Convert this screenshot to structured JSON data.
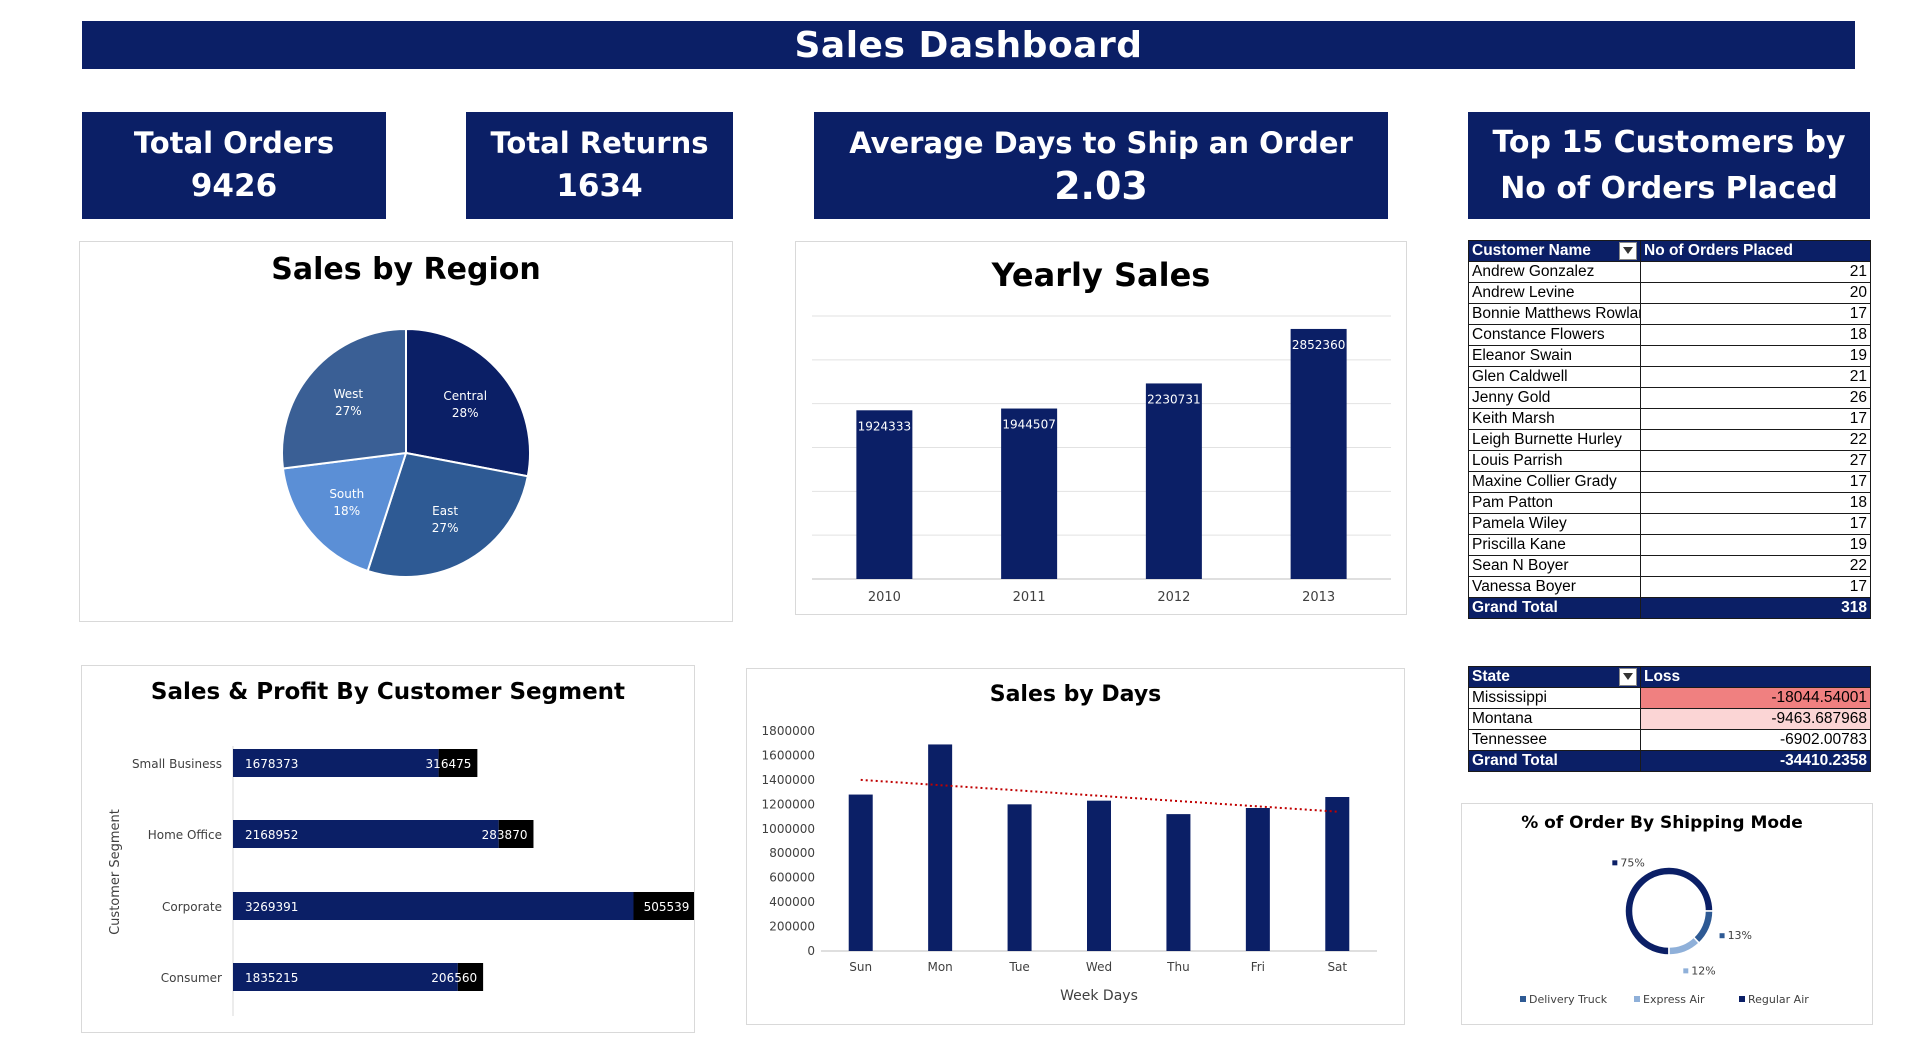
{
  "dashboard": {
    "title": "Sales Dashboard",
    "kpis": {
      "total_orders_label": "Total Orders",
      "total_orders_value": "9426",
      "total_returns_label": "Total Returns",
      "total_returns_value": "1634",
      "avg_ship_label": "Average Days to Ship an Order",
      "avg_ship_value": "2.03",
      "top_customers_label_1": "Top 15 Customers by",
      "top_customers_label_2": "No of  Orders Placed"
    }
  },
  "colors": {
    "navy": "#0b1f66",
    "pie_central": "#0b1f66",
    "pie_east": "#2e5a94",
    "pie_south": "#5b8fd6",
    "pie_west": "#3a5f95",
    "profit_bar": "#000000",
    "trendline": "#c00000",
    "loss_strong": "#f08080",
    "loss_light": "#fbd5d5",
    "donut_express": "#8fb0d9",
    "donut_delivery": "#2e5a94"
  },
  "customers_table": {
    "headers": [
      "Customer Name",
      "No of Orders Placed"
    ],
    "rows": [
      [
        "Andrew Gonzalez",
        "21"
      ],
      [
        "Andrew Levine",
        "20"
      ],
      [
        "Bonnie Matthews Rowlands",
        "17"
      ],
      [
        "Constance Flowers",
        "18"
      ],
      [
        "Eleanor Swain",
        "19"
      ],
      [
        "Glen Caldwell",
        "21"
      ],
      [
        "Jenny Gold",
        "26"
      ],
      [
        "Keith Marsh",
        "17"
      ],
      [
        "Leigh Burnette Hurley",
        "22"
      ],
      [
        "Louis Parrish",
        "27"
      ],
      [
        "Maxine Collier Grady",
        "17"
      ],
      [
        "Pam Patton",
        "18"
      ],
      [
        "Pamela Wiley",
        "17"
      ],
      [
        "Priscilla Kane",
        "19"
      ],
      [
        "Sean N Boyer",
        "22"
      ],
      [
        "Vanessa Boyer",
        "17"
      ]
    ],
    "total_label": "Grand Total",
    "total_value": "318"
  },
  "loss_table": {
    "headers": [
      "State",
      "Loss"
    ],
    "rows": [
      [
        "Mississippi",
        "-18044.54001"
      ],
      [
        "Montana",
        "-9463.687968"
      ],
      [
        "Tennessee",
        "-6902.00783"
      ]
    ],
    "total_label": "Grand Total",
    "total_value": "-34410.2358"
  },
  "chart_data": [
    {
      "id": "region",
      "type": "pie",
      "title": "Sales by Region",
      "slices": [
        {
          "label": "Central",
          "value": 28,
          "pct_label": "28%"
        },
        {
          "label": "East",
          "value": 27,
          "pct_label": "27%"
        },
        {
          "label": "South",
          "value": 18,
          "pct_label": "18%"
        },
        {
          "label": "West",
          "value": 27,
          "pct_label": "27%"
        }
      ]
    },
    {
      "id": "yearly",
      "type": "bar",
      "title": "Yearly Sales",
      "categories": [
        "2010",
        "2011",
        "2012",
        "2013"
      ],
      "values": [
        1924333,
        1944507,
        2230731,
        2852360
      ],
      "ylim": [
        0,
        3000000
      ],
      "grid": true
    },
    {
      "id": "segment",
      "type": "bar",
      "orientation": "horizontal",
      "stacked": true,
      "title": "Sales & Profit By Customer Segment",
      "ylabel": "Customer Segment",
      "categories": [
        "Small Business",
        "Home Office",
        "Corporate",
        "Consumer"
      ],
      "series": [
        {
          "values": [
            1678373,
            2168952,
            3269391,
            1835215
          ]
        },
        {
          "values": [
            316475,
            283870,
            505539,
            206560
          ]
        }
      ],
      "xlim": [
        0,
        4000000
      ]
    },
    {
      "id": "days",
      "type": "bar",
      "title": "Sales by Days",
      "xlabel": "Week Days",
      "categories": [
        "Sun",
        "Mon",
        "Tue",
        "Wed",
        "Thu",
        "Fri",
        "Sat"
      ],
      "values": [
        1280000,
        1690000,
        1200000,
        1230000,
        1120000,
        1170000,
        1260000
      ],
      "ylim": [
        0,
        1800000
      ],
      "yticks": [
        "0",
        "200000",
        "400000",
        "600000",
        "800000",
        "1000000",
        "1200000",
        "1400000",
        "1600000",
        "1800000"
      ],
      "trendline": {
        "start": 1400000,
        "end": 1140000
      }
    },
    {
      "id": "shipping",
      "type": "pie",
      "donut": true,
      "title": "% of Order By Shipping Mode",
      "slices": [
        {
          "label": "Regular Air",
          "value": 75,
          "pct_label": "75%"
        },
        {
          "label": "Delivery Truck",
          "value": 13,
          "pct_label": "13%"
        },
        {
          "label": "Express Air",
          "value": 12,
          "pct_label": "12%"
        }
      ],
      "legend_position": "bottom"
    }
  ]
}
